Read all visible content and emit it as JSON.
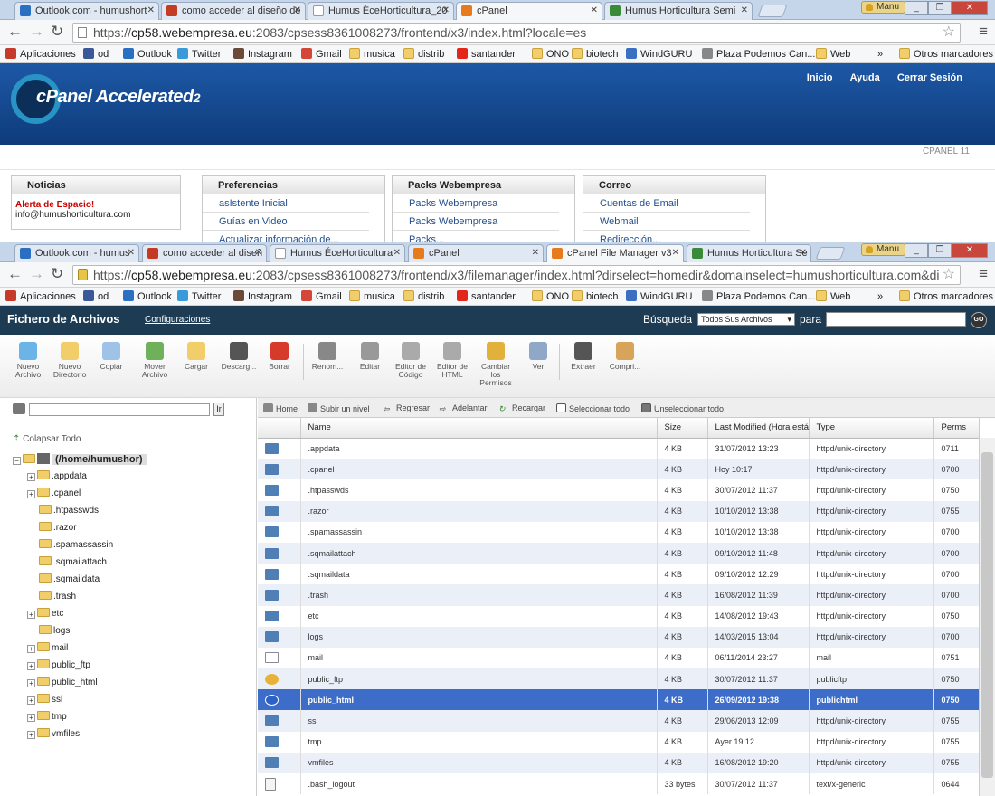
{
  "window1": {
    "tabs": [
      {
        "title": "Outlook.com - humushort",
        "color": "#2a6fc2"
      },
      {
        "title": "como acceder al diseño de",
        "color": "#c23b22"
      },
      {
        "title": "Humus ÉceHorticultura_20",
        "color": "#999999"
      },
      {
        "title": "cPanel",
        "color": "#e87a1e"
      },
      {
        "title": "Humus Horticultura Semi",
        "color": "#3a8a3a"
      }
    ],
    "user_badge": "Manu",
    "url_prefix": "https://",
    "url_host": "cp58.webempresa.eu",
    "url_rest": ":2083/cpsess8361008273/frontend/x3/index.html?locale=es",
    "cpanel": {
      "logo_text": "cPanel Accelerated",
      "logo_sub": "2",
      "links": [
        "Inicio",
        "Ayuda",
        "Cerrar Sesión"
      ],
      "version": "CPANEL 11",
      "noticias_title": "Noticias",
      "noticias_alert": "Alerta de Espacio!",
      "noticias_email": "info@humushorticultura.com",
      "boxes": [
        {
          "title": "Preferencias",
          "items": [
            "asIstente Inicial",
            "Guías en Video",
            "Actualizar información de..."
          ]
        },
        {
          "title": "Packs Webempresa",
          "items": [
            "Packs Webempresa",
            "Packs Webempresa",
            "Packs..."
          ]
        },
        {
          "title": "Correo",
          "items": [
            "Cuentas de Email",
            "Webmail",
            "Redirección..."
          ]
        }
      ]
    }
  },
  "bookmarks": [
    {
      "label": "Aplicaciones",
      "icon": "apps-icon"
    },
    {
      "label": "od",
      "icon": "facebook-icon"
    },
    {
      "label": "Outlook",
      "icon": "outlook-icon"
    },
    {
      "label": "Twitter",
      "icon": "twitter-icon"
    },
    {
      "label": "Instagram",
      "icon": "instagram-icon"
    },
    {
      "label": "Gmail",
      "icon": "gmail-icon"
    },
    {
      "label": "musica",
      "icon": "folder-icon"
    },
    {
      "label": "distrib",
      "icon": "folder-icon"
    },
    {
      "label": "santander",
      "icon": "santander-icon"
    },
    {
      "label": "ONO",
      "icon": "folder-icon"
    },
    {
      "label": "biotech",
      "icon": "folder-icon"
    },
    {
      "label": "WindGURU",
      "icon": "windguru-icon"
    },
    {
      "label": "Plaza Podemos Can...",
      "icon": "page-icon"
    },
    {
      "label": "Web",
      "icon": "folder-icon"
    },
    {
      "label": "»",
      "icon": ""
    },
    {
      "label": "Otros marcadores",
      "icon": "folder-icon"
    }
  ],
  "window2": {
    "tabs": [
      {
        "title": "Outlook.com - humus",
        "color": "#2a6fc2"
      },
      {
        "title": "como acceder al diseñ",
        "color": "#c23b22"
      },
      {
        "title": "Humus ÉceHorticultura",
        "color": "#999999"
      },
      {
        "title": "cPanel",
        "color": "#e87a1e"
      },
      {
        "title": "cPanel File Manager v3",
        "color": "#e87a1e"
      },
      {
        "title": "Humus Horticultura Se",
        "color": "#3a8a3a"
      }
    ],
    "user_badge": "Manu",
    "url_prefix": "https://",
    "url_host": "cp58.webempresa.eu",
    "url_rest": ":2083/cpsess8361008273/frontend/x3/filemanager/index.html?dirselect=homedir&domainselect=humushorticultura.com&di",
    "fm": {
      "title": "Fichero de Archivos",
      "config_link": "Configuraciones",
      "search_label": "Búsqueda",
      "search_scope": "Todos Sus Archivos",
      "search_for": "para",
      "go_label": "GO",
      "tools": [
        {
          "label": "Nuevo Archivo",
          "icon": "new-file-icon",
          "color": "#6cb3e8"
        },
        {
          "label": "Nuevo Directorio",
          "icon": "new-folder-icon",
          "color": "#f2ce6a"
        },
        {
          "label": "Copiar",
          "icon": "copy-icon",
          "color": "#9fc3e6"
        },
        {
          "label": "Mover Archivo",
          "icon": "move-icon",
          "color": "#6fb05a"
        },
        {
          "label": "Cargar",
          "icon": "upload-icon",
          "color": "#f2ce6a"
        },
        {
          "label": "Descarg...",
          "icon": "download-icon",
          "color": "#555555"
        },
        {
          "label": "Borrar",
          "icon": "delete-icon",
          "color": "#d63a2a"
        },
        {
          "label": "Renom...",
          "icon": "rename-icon",
          "color": "#888888"
        },
        {
          "label": "Editar",
          "icon": "edit-icon",
          "color": "#999999"
        },
        {
          "label": "Editor de Código",
          "icon": "code-editor-icon",
          "color": "#aaaaaa"
        },
        {
          "label": "Editor de HTML",
          "icon": "html-editor-icon",
          "color": "#aaaaaa"
        },
        {
          "label": "Cambiar los Permisos",
          "icon": "key-icon",
          "color": "#e2b13c"
        },
        {
          "label": "Ver",
          "icon": "view-icon",
          "color": "#8fa8c8"
        },
        {
          "label": "Extraer",
          "icon": "extract-icon",
          "color": "#555555"
        },
        {
          "label": "Compri...",
          "icon": "compress-icon",
          "color": "#d8a35a"
        }
      ],
      "tree": {
        "go_label": "Ir",
        "collapse_all": "Colapsar Todo",
        "root": "(/home/humushor)",
        "nodes": [
          {
            "name": ".appdata",
            "expandable": true
          },
          {
            "name": ".cpanel",
            "expandable": true
          },
          {
            "name": ".htpasswds",
            "expandable": false
          },
          {
            "name": ".razor",
            "expandable": false
          },
          {
            "name": ".spamassassin",
            "expandable": false
          },
          {
            "name": ".sqmailattach",
            "expandable": false
          },
          {
            "name": ".sqmaildata",
            "expandable": false
          },
          {
            "name": ".trash",
            "expandable": false
          },
          {
            "name": "etc",
            "expandable": true
          },
          {
            "name": "logs",
            "expandable": false
          },
          {
            "name": "mail",
            "expandable": true
          },
          {
            "name": "public_ftp",
            "expandable": true
          },
          {
            "name": "public_html",
            "expandable": true
          },
          {
            "name": "ssl",
            "expandable": true
          },
          {
            "name": "tmp",
            "expandable": true
          },
          {
            "name": "vmfiles",
            "expandable": true
          }
        ]
      },
      "actions": [
        "Home",
        "Subir un nivel",
        "Regresar",
        "Adelantar",
        "Recargar",
        "Seleccionar todo",
        "Unseleccionar todo"
      ],
      "columns": [
        "Name",
        "Size",
        "Last Modified (Hora está",
        "Type",
        "Perms"
      ],
      "rows": [
        {
          "name": ".appdata",
          "size": "4 KB",
          "modified": "31/07/2012 13:23",
          "type": "httpd/unix-directory",
          "perms": "0711",
          "icon": "folder"
        },
        {
          "name": ".cpanel",
          "size": "4 KB",
          "modified": "Hoy 10:17",
          "type": "httpd/unix-directory",
          "perms": "0700",
          "icon": "folder"
        },
        {
          "name": ".htpasswds",
          "size": "4 KB",
          "modified": "30/07/2012 11:37",
          "type": "httpd/unix-directory",
          "perms": "0750",
          "icon": "folder"
        },
        {
          "name": ".razor",
          "size": "4 KB",
          "modified": "10/10/2012 13:38",
          "type": "httpd/unix-directory",
          "perms": "0755",
          "icon": "folder"
        },
        {
          "name": ".spamassassin",
          "size": "4 KB",
          "modified": "10/10/2012 13:38",
          "type": "httpd/unix-directory",
          "perms": "0700",
          "icon": "folder"
        },
        {
          "name": ".sqmailattach",
          "size": "4 KB",
          "modified": "09/10/2012 11:48",
          "type": "httpd/unix-directory",
          "perms": "0700",
          "icon": "folder"
        },
        {
          "name": ".sqmaildata",
          "size": "4 KB",
          "modified": "09/10/2012 12:29",
          "type": "httpd/unix-directory",
          "perms": "0700",
          "icon": "folder"
        },
        {
          "name": ".trash",
          "size": "4 KB",
          "modified": "16/08/2012 11:39",
          "type": "httpd/unix-directory",
          "perms": "0700",
          "icon": "folder"
        },
        {
          "name": "etc",
          "size": "4 KB",
          "modified": "14/08/2012 19:43",
          "type": "httpd/unix-directory",
          "perms": "0750",
          "icon": "folder"
        },
        {
          "name": "logs",
          "size": "4 KB",
          "modified": "14/03/2015 13:04",
          "type": "httpd/unix-directory",
          "perms": "0700",
          "icon": "folder"
        },
        {
          "name": "mail",
          "size": "4 KB",
          "modified": "06/11/2014 23:27",
          "type": "mail",
          "perms": "0751",
          "icon": "mail"
        },
        {
          "name": "public_ftp",
          "size": "4 KB",
          "modified": "30/07/2012 11:37",
          "type": "publicftp",
          "perms": "0750",
          "icon": "ftp"
        },
        {
          "name": "public_html",
          "size": "4 KB",
          "modified": "26/09/2012 19:38",
          "type": "publichtml",
          "perms": "0750",
          "icon": "web",
          "selected": true
        },
        {
          "name": "ssl",
          "size": "4 KB",
          "modified": "29/06/2013 12:09",
          "type": "httpd/unix-directory",
          "perms": "0755",
          "icon": "folder"
        },
        {
          "name": "tmp",
          "size": "4 KB",
          "modified": "Ayer 19:12",
          "type": "httpd/unix-directory",
          "perms": "0755",
          "icon": "folder"
        },
        {
          "name": "vmfiles",
          "size": "4 KB",
          "modified": "16/08/2012 19:20",
          "type": "httpd/unix-directory",
          "perms": "0755",
          "icon": "folder"
        },
        {
          "name": ".bash_logout",
          "size": "33 bytes",
          "modified": "30/07/2012 11:37",
          "type": "text/x-generic",
          "perms": "0644",
          "icon": "txt"
        }
      ]
    }
  }
}
